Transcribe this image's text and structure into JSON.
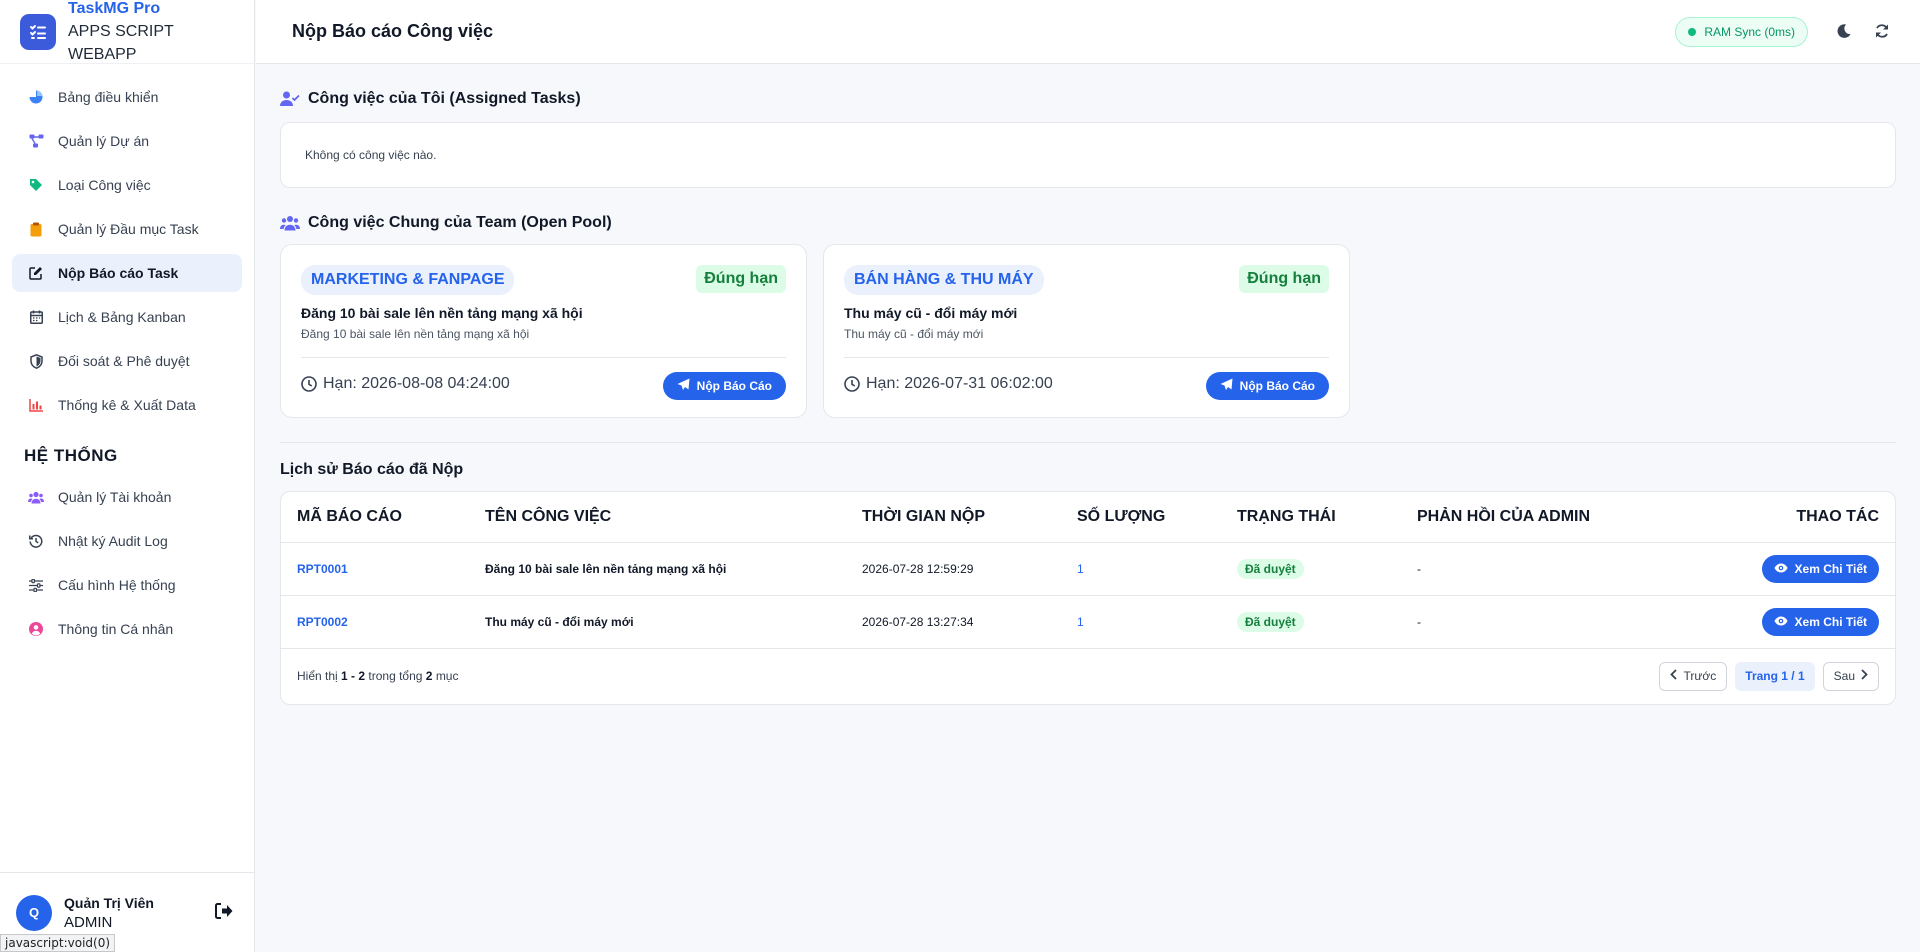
{
  "brand": {
    "name": "TaskMG Pro",
    "sub_line1": "APPS SCRIPT",
    "sub_line2": "WEBAPP"
  },
  "sidebar": {
    "items": [
      {
        "label": "Bảng điều khiển",
        "icon": "pie-chart-icon",
        "color": "#3b82f6"
      },
      {
        "label": "Quản lý Dự án",
        "icon": "project-diagram-icon",
        "color": "#6366f1"
      },
      {
        "label": "Loại Công việc",
        "icon": "tags-icon",
        "color": "#10b981"
      },
      {
        "label": "Quản lý Đầu mục Task",
        "icon": "clipboard-icon",
        "color": "#f59e0b"
      },
      {
        "label": "Nộp Báo cáo Task",
        "icon": "edit-icon",
        "color": "#374151",
        "active": true
      },
      {
        "label": "Lịch & Bảng Kanban",
        "icon": "calendar-icon",
        "color": "#374151"
      },
      {
        "label": "Đối soát & Phê duyệt",
        "icon": "shield-icon",
        "color": "#374151"
      },
      {
        "label": "Thống kê & Xuất Data",
        "icon": "bar-chart-icon",
        "color": "#ef4444"
      }
    ],
    "section_title": "HỆ THỐNG",
    "system_items": [
      {
        "label": "Quản lý Tài khoản",
        "icon": "users-icon",
        "color": "#8b5cf6"
      },
      {
        "label": "Nhật ký Audit Log",
        "icon": "history-icon",
        "color": "#374151"
      },
      {
        "label": "Cấu hình Hệ thống",
        "icon": "sliders-icon",
        "color": "#374151"
      },
      {
        "label": "Thông tin Cá nhân",
        "icon": "user-circle-icon",
        "color": "#ec4899"
      }
    ]
  },
  "user": {
    "initial": "Q",
    "name": "Quản Trị Viên",
    "role": "ADMIN"
  },
  "status_bar": "javascript:void(0)",
  "header": {
    "title": "Nộp Báo cáo Công việc",
    "ram_sync": "RAM Sync (0ms)"
  },
  "assigned": {
    "title": "Công việc của Tôi (Assigned Tasks)",
    "empty_text": "Không có công việc nào."
  },
  "open_pool": {
    "title": "Công việc Chung của Team (Open Pool)",
    "cards": [
      {
        "tag": "MARKETING & FANPAGE",
        "status": "Đúng hạn",
        "title": "Đăng 10 bài sale lên nền tảng mạng xã hội",
        "desc": "Đăng 10 bài sale lên nền tảng mạng xã hội",
        "deadline": "Hạn: 2026-08-08 04:24:00",
        "button": "Nộp Báo Cáo"
      },
      {
        "tag": "BÁN HÀNG & THU MÁY",
        "status": "Đúng hạn",
        "title": "Thu máy cũ - đổi máy mới",
        "desc": "Thu máy cũ - đổi máy mới",
        "deadline": "Hạn: 2026-07-31 06:02:00",
        "button": "Nộp Báo Cáo"
      }
    ]
  },
  "history": {
    "title": "Lịch sử Báo cáo đã Nộp",
    "columns": [
      "MÃ BÁO CÁO",
      "TÊN CÔNG VIỆC",
      "THỜI GIAN NỘP",
      "SỐ LƯỢNG",
      "TRẠNG THÁI",
      "PHẢN HỒI CỦA ADMIN",
      "THAO TÁC"
    ],
    "rows": [
      {
        "code": "RPT0001",
        "name": "Đăng 10 bài sale lên nền tảng mạng xã hội",
        "time": "2026-07-28 12:59:29",
        "qty": "1",
        "status": "Đã duyệt",
        "feedback": "-",
        "action": "Xem Chi Tiết"
      },
      {
        "code": "RPT0002",
        "name": "Thu máy cũ - đổi máy mới",
        "time": "2026-07-28 13:27:34",
        "qty": "1",
        "status": "Đã duyệt",
        "feedback": "-",
        "action": "Xem Chi Tiết"
      }
    ],
    "footer": {
      "prefix": "Hiển thị",
      "range": "1 - 2",
      "middle": "trong tổng",
      "total": "2",
      "suffix": "mục"
    },
    "pagination": {
      "prev": "Trước",
      "page": "Trang 1 / 1",
      "next": "Sau"
    }
  }
}
